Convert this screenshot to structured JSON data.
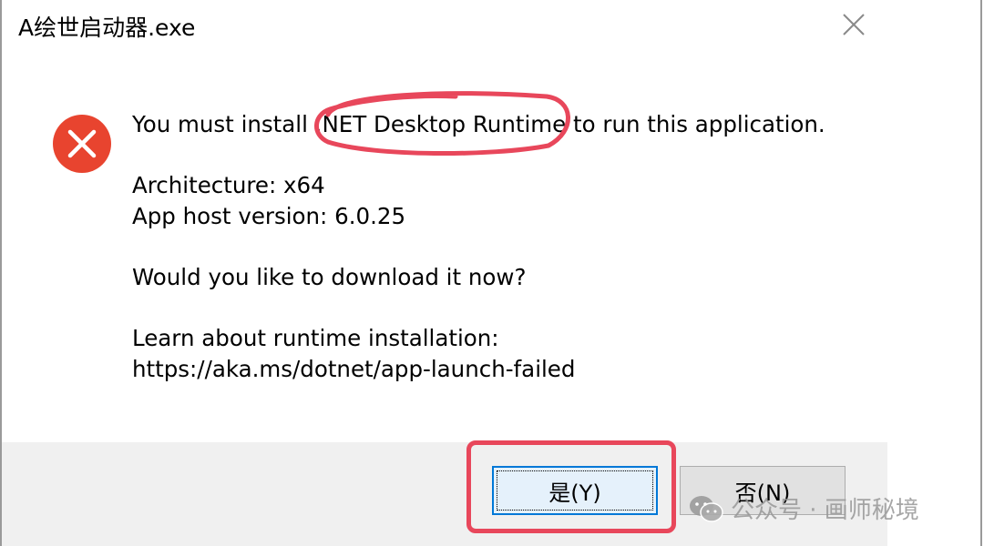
{
  "window": {
    "title": "A绘世启动器.exe",
    "close_icon": "close-icon"
  },
  "dialog": {
    "icon": "error-icon",
    "message_line1": "You must install .NET Desktop Runtime to run this application.",
    "architecture": "Architecture: x64",
    "host_version": "App host version: 6.0.25",
    "question": "Would you like to download it now?",
    "learn_label": "Learn about runtime installation:",
    "learn_url": "https://aka.ms/dotnet/app-launch-failed"
  },
  "buttons": {
    "yes_label": "是(Y)",
    "no_label": "否(N)"
  },
  "watermark": {
    "text": "公众号 · 画师秘境",
    "icon": "wechat-icon"
  },
  "colors": {
    "error_red": "#e8442f",
    "annotation_red": "#e8475b",
    "focus_blue": "#0078d7",
    "footer_bg": "#f0f0f0"
  }
}
